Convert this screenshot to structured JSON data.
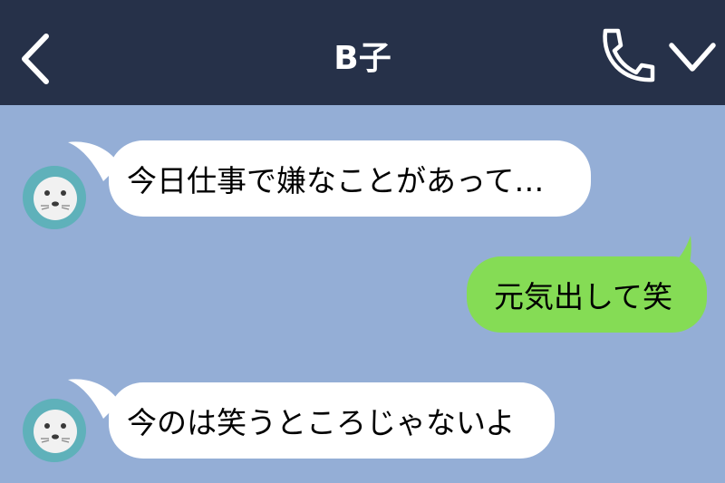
{
  "header": {
    "title": "B子",
    "back_icon": "chevron-left-icon",
    "call_icon": "phone-icon",
    "menu_icon": "chevron-down-icon",
    "background": "#263149",
    "text_color": "#ffffff"
  },
  "chat": {
    "background": "#94aed6",
    "messages": [
      {
        "sender": "other",
        "text": "今日仕事で嫌なことがあって…"
      },
      {
        "sender": "me",
        "text": "元気出して笑"
      },
      {
        "sender": "other",
        "text": "今のは笑うところじゃないよ"
      }
    ],
    "avatar_icon": "seal-avatar-icon",
    "incoming_color": "#ffffff",
    "outgoing_color": "#85dc55"
  }
}
